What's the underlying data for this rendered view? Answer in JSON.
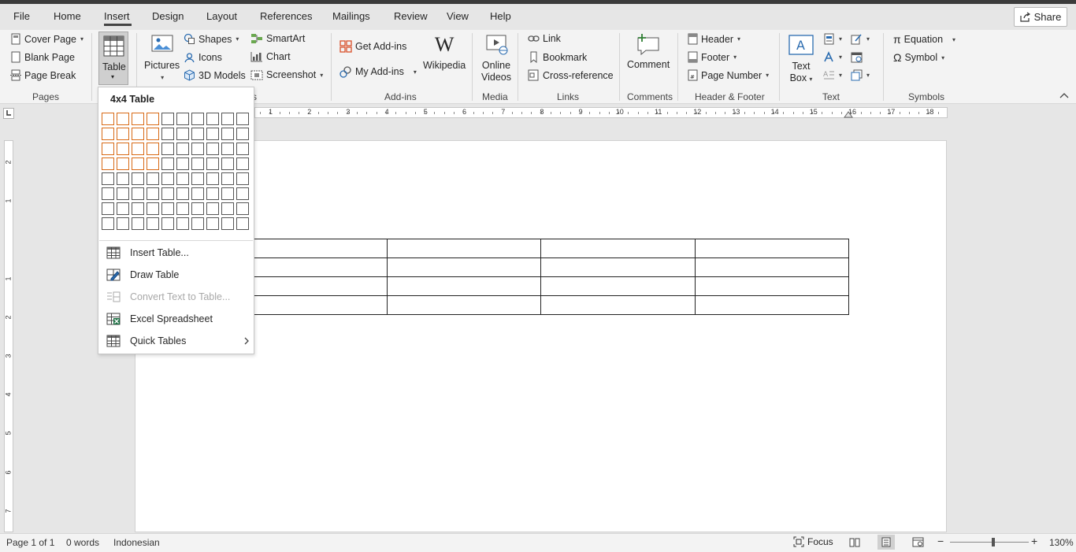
{
  "tabs": [
    "File",
    "Home",
    "Insert",
    "Design",
    "Layout",
    "References",
    "Mailings",
    "Review",
    "View",
    "Help"
  ],
  "share_label": "Share",
  "ribbon": {
    "pages": {
      "cover_page": "Cover Page",
      "blank_page": "Blank Page",
      "page_break": "Page Break",
      "group": "Pages"
    },
    "table": {
      "label": "Table"
    },
    "illustrations": {
      "pictures": "Pictures",
      "shapes": "Shapes",
      "icons": "Icons",
      "models": "3D Models",
      "smartart": "SmartArt",
      "chart": "Chart",
      "screenshot": "Screenshot",
      "group_tail": "s"
    },
    "addins": {
      "get": "Get Add-ins",
      "my": "My Add-ins",
      "wikipedia": "Wikipedia",
      "group": "Add-ins"
    },
    "media": {
      "online_videos_1": "Online",
      "online_videos_2": "Videos",
      "group": "Media"
    },
    "links": {
      "link": "Link",
      "bookmark": "Bookmark",
      "crossref": "Cross-reference",
      "group": "Links"
    },
    "comments": {
      "comment": "Comment",
      "group": "Comments"
    },
    "header_footer": {
      "header": "Header",
      "footer": "Footer",
      "page_number": "Page Number",
      "group": "Header & Footer"
    },
    "text": {
      "textbox_1": "Text",
      "textbox_2": "Box",
      "group": "Text"
    },
    "symbols": {
      "equation": "Equation",
      "symbol": "Symbol",
      "group": "Symbols"
    }
  },
  "table_menu": {
    "title": "4x4 Table",
    "grid_cols": 10,
    "grid_rows": 8,
    "selected_cols": 4,
    "selected_rows": 4,
    "items": [
      {
        "label": "Insert Table...",
        "icon": "table-grid-icon",
        "enabled": true,
        "submenu": false
      },
      {
        "label": "Draw Table",
        "icon": "draw-table-icon",
        "enabled": true,
        "submenu": false
      },
      {
        "label": "Convert Text to Table...",
        "icon": "convert-text-table-icon",
        "enabled": false,
        "submenu": false
      },
      {
        "label": "Excel Spreadsheet",
        "icon": "excel-icon",
        "enabled": true,
        "submenu": false
      },
      {
        "label": "Quick Tables",
        "icon": "quick-tables-icon",
        "enabled": true,
        "submenu": true
      }
    ]
  },
  "hruler_numbers": [
    "1",
    "2",
    "3",
    "4",
    "5",
    "6",
    "7",
    "8",
    "9",
    "10",
    "11",
    "12",
    "13",
    "14",
    "15",
    "16",
    "17",
    "18"
  ],
  "vruler_numbers": [
    "2",
    "1",
    "1",
    "2",
    "3",
    "4",
    "5",
    "6",
    "7"
  ],
  "document": {
    "table_rows": 4,
    "table_cols": 4
  },
  "status": {
    "page": "Page 1 of 1",
    "words": "0 words",
    "language": "Indonesian",
    "focus": "Focus",
    "zoom": "130%",
    "zoom_fraction": 0.55
  },
  "colors": {
    "selection_orange": "#d86a16",
    "excel_green": "#1e7145",
    "accent_blue": "#2b6cb0"
  }
}
